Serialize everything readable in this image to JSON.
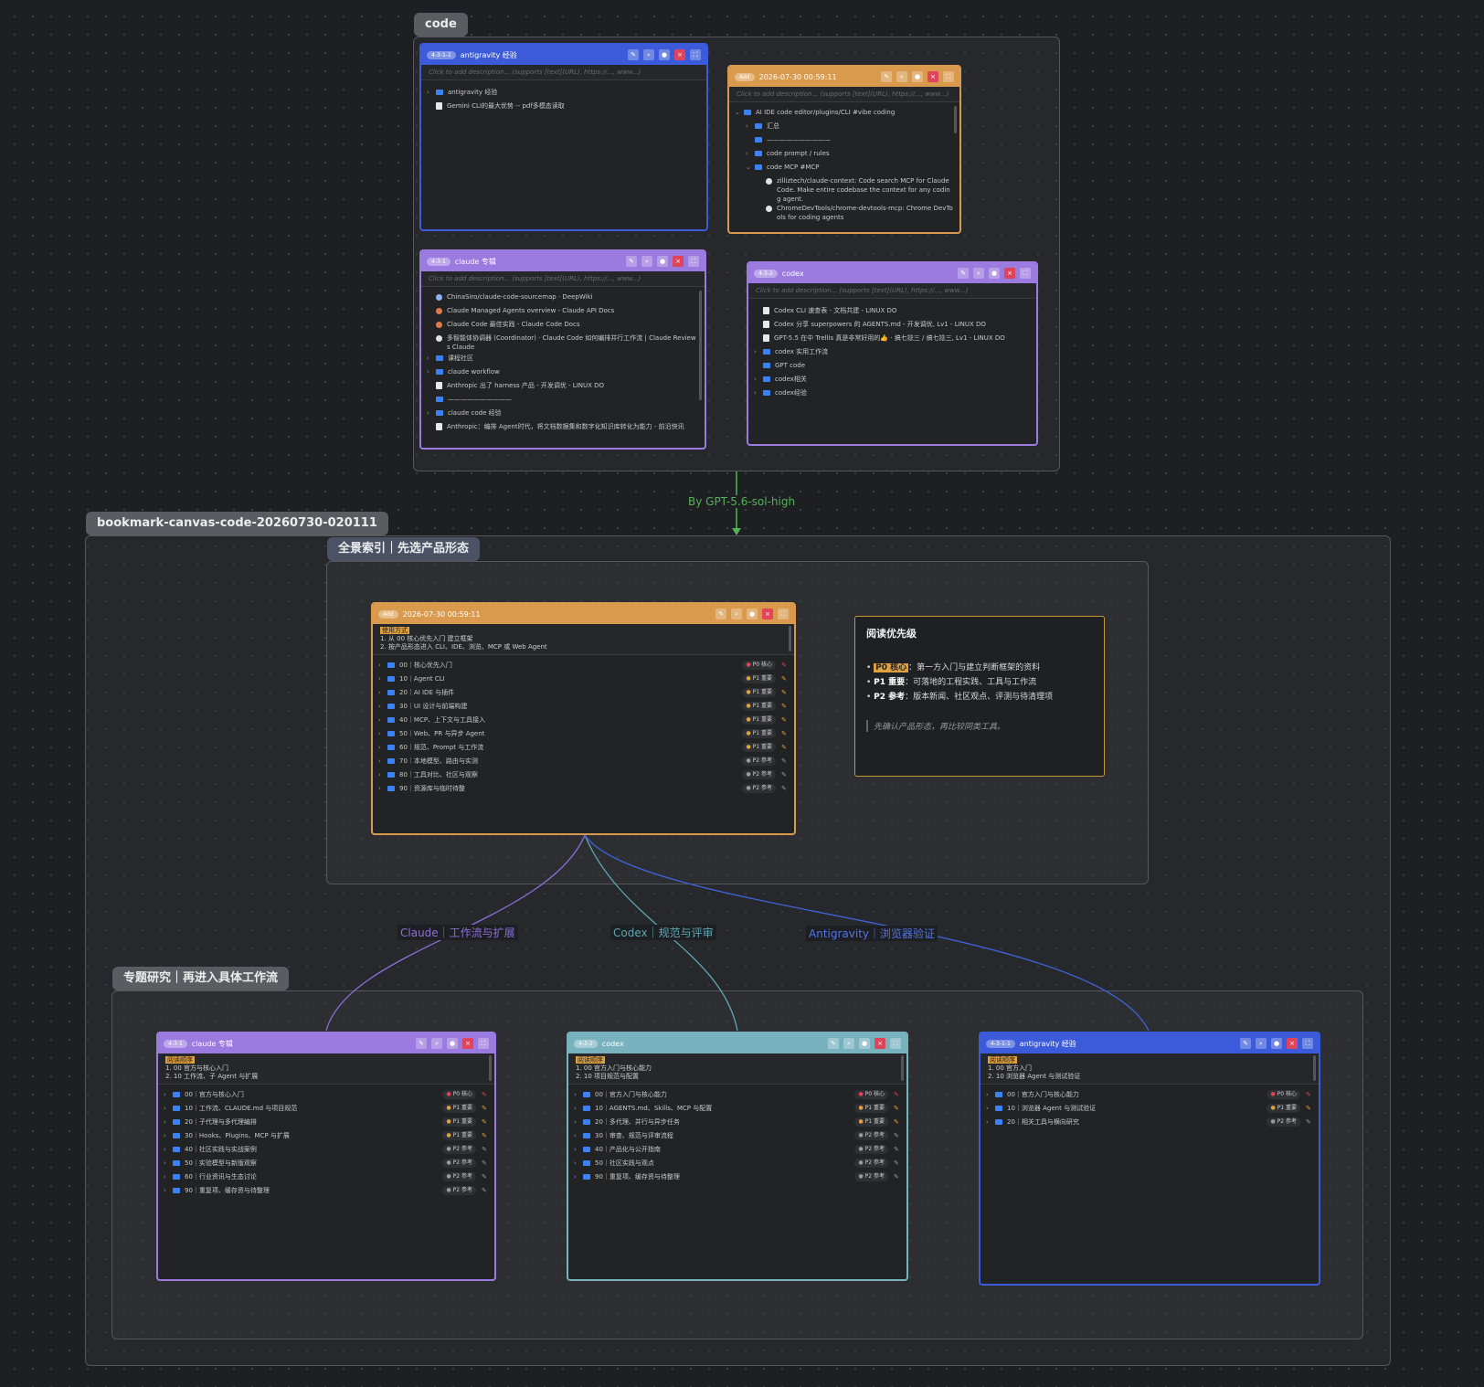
{
  "canvas": {
    "groups": {
      "code": "code",
      "bookmark_canvas": "bookmark-canvas-code-20260730-020111",
      "overview": "全景索引｜先选产品形态",
      "topic": "专题研究｜再进入具体工作流"
    },
    "edges": {
      "gpt": "By GPT-5.6-sol-high",
      "claude": "Claude｜工作流与扩展",
      "codex": "Codex｜规范与评审",
      "antigravity": "Antigravity｜浏览器验证"
    },
    "colors": {
      "blue_header": "#3b5bdb",
      "orange_header": "#d99a4e",
      "purple_header": "#9b7be0",
      "teal_header": "#79b2bf",
      "edge_green": "#52b356",
      "edge_purple": "#8b6fd8",
      "edge_teal": "#5fa6b4",
      "edge_blue": "#3e63d8"
    }
  },
  "nodes": {
    "antigravity_top": {
      "badge": "4-3-1-1",
      "title": "antigravity 经验",
      "desc": "Click to add description... (supports [text](URL), https://..., www...)",
      "rows": [
        {
          "label": "antigravity 经验"
        },
        {
          "label": "Gemini CLI的最大优势 -- pdf多模态读取"
        }
      ]
    },
    "orange_top": {
      "badge": "Add",
      "title": "2026-07-30 00:59:11",
      "desc": "Click to add description... (supports [text](URL), https://..., www...)",
      "rows": [
        {
          "label": "AI IDE code editor/plugins/CLI #vibe coding"
        },
        {
          "label": "汇总"
        },
        {
          "label": "——————————"
        },
        {
          "label": "code prompt / rules"
        },
        {
          "label": "code MCP #MCP"
        },
        {
          "label": "zilliztech/claude-context: Code search MCP for Claude Code. Make entire codebase the context for any coding agent."
        },
        {
          "label": "ChromeDevTools/chrome-devtools-mcp: Chrome DevTools for coding agents"
        }
      ]
    },
    "claude_top": {
      "badge": "4-3-1",
      "title": "claude 专辑",
      "desc": "Click to add description... (supports [text](URL), https://..., www...)",
      "rows": [
        {
          "label": "ChinaSiro/claude-code-sourcemap · DeepWiki"
        },
        {
          "label": "Claude Managed Agents overview - Claude API Docs"
        },
        {
          "label": "Claude Code 最佳实践 - Claude Code Docs"
        },
        {
          "label": "多智能体协调器 (Coordinator) · Claude Code 如何编排并行工作流 | Claude Reviews Claude"
        },
        {
          "label": "课程社区"
        },
        {
          "label": "claude workflow"
        },
        {
          "label": "Anthropic 出了 harness 产品 - 开发调优 - LINUX DO"
        },
        {
          "label": "——————————"
        },
        {
          "label": "claude code 经验"
        },
        {
          "label": "Anthropic：编排 Agent时代，将文档数据集和数字化知识库转化为能力 - 前沿快讯"
        }
      ]
    },
    "codex_top": {
      "badge": "4-3-2",
      "title": "codex",
      "desc": "Click to add description... (supports [text](URL), https://..., www...)",
      "rows": [
        {
          "label": "Codex CLI 速查表 - 文档共建 - LINUX DO"
        },
        {
          "label": "Codex 分享 superpowers 的 AGENTS.md - 开发调优, Lv1 - LINUX DO"
        },
        {
          "label": "GPT-5.5 在中 Trellis 真是非常好用的👍 · 搞七捻三 / 搞七捻三, Lv1 - LINUX DO"
        },
        {
          "label": "codex 实用工作流"
        },
        {
          "label": "GPT code"
        },
        {
          "label": "codex相关"
        },
        {
          "label": "codex经验"
        }
      ]
    },
    "overview_orange": {
      "badge": "Add",
      "title": "2026-07-30 00:59:11",
      "note_tag": "使用方式",
      "note_lines": [
        "1. 从 00 核心优先入门 建立框架",
        "2. 按产品形态进入 CLI、IDE、浏览、MCP 或 Web Agent"
      ],
      "rows": [
        {
          "label": "00｜核心优先入门",
          "tag": "P0 核心"
        },
        {
          "label": "10｜Agent CLI",
          "tag": "P1 重要"
        },
        {
          "label": "20｜AI IDE 与插件",
          "tag": "P1 重要"
        },
        {
          "label": "30｜UI 设计与前端构建",
          "tag": "P1 重要"
        },
        {
          "label": "40｜MCP、上下文与工具接入",
          "tag": "P1 重要"
        },
        {
          "label": "50｜Web、PR 与异步 Agent",
          "tag": "P1 重要"
        },
        {
          "label": "60｜规范、Prompt 与工作流",
          "tag": "P1 重要"
        },
        {
          "label": "70｜本地模型、路由与实测",
          "tag": "P2 参考"
        },
        {
          "label": "80｜工具对比、社区与观察",
          "tag": "P2 参考"
        },
        {
          "label": "90｜资源库与临时待整",
          "tag": "P2 参考"
        }
      ]
    },
    "claude_bottom": {
      "badge": "4-3-1",
      "title": "claude 专辑",
      "note_tag": "阅读顺序",
      "note_lines": [
        "1. 00 官方与核心入门",
        "2. 10 工作流、子 Agent 与扩展"
      ],
      "rows": [
        {
          "label": "00｜官方与核心入门",
          "tag": "P0 核心"
        },
        {
          "label": "10｜工作流、CLAUDE.md 与项目规范",
          "tag": "P1 重要"
        },
        {
          "label": "20｜子代理与多代理编排",
          "tag": "P1 重要"
        },
        {
          "label": "30｜Hooks、Plugins、MCP 与扩展",
          "tag": "P1 重要"
        },
        {
          "label": "40｜社区实践与实战案例",
          "tag": "P2 参考"
        },
        {
          "label": "50｜实验模型与新版观察",
          "tag": "P2 参考"
        },
        {
          "label": "60｜行业资讯与生态讨论",
          "tag": "P2 参考"
        },
        {
          "label": "90｜重复项、缓存资与待整理",
          "tag": "P2 参考"
        }
      ]
    },
    "codex_bottom": {
      "badge": "4-3-2",
      "title": "codex",
      "note_tag": "阅读顺序",
      "note_lines": [
        "1. 00 官方入门与核心能力",
        "2. 10 项目规范与配置"
      ],
      "rows": [
        {
          "label": "00｜官方入门与核心能力",
          "tag": "P0 核心"
        },
        {
          "label": "10｜AGENTS.md、Skills、MCP 与配置",
          "tag": "P1 重要"
        },
        {
          "label": "20｜多代理、并行与异步任务",
          "tag": "P1 重要"
        },
        {
          "label": "30｜审查、规范与评审流程",
          "tag": "P2 参考"
        },
        {
          "label": "40｜产品化与公开指南",
          "tag": "P2 参考"
        },
        {
          "label": "50｜社区实践与观点",
          "tag": "P2 参考"
        },
        {
          "label": "90｜重复项、缓存资与待整理",
          "tag": "P2 参考"
        }
      ]
    },
    "antigravity_bottom": {
      "badge": "4-3-1-1",
      "title": "antigravity 经验",
      "note_tag": "阅读顺序",
      "note_lines": [
        "1. 00 官方入门",
        "2. 10 浏览器 Agent 与测试验证"
      ],
      "rows": [
        {
          "label": "00｜官方入门与核心能力",
          "tag": "P0 核心"
        },
        {
          "label": "10｜浏览器 Agent 与测试验证",
          "tag": "P1 重要"
        },
        {
          "label": "20｜相关工具与横向研究",
          "tag": "P2 参考"
        }
      ]
    }
  },
  "reading_priority": {
    "title": "阅读优先级",
    "items": [
      {
        "key": "P0 核心",
        "text": "：第一方入门与建立判断框架的资料"
      },
      {
        "key": "P1 重要",
        "text": "：可落地的工程实践、工具与工作流"
      },
      {
        "key": "P2 参考",
        "text": "：版本新闻、社区观点、评测与待清理项"
      }
    ],
    "quote": "先确认产品形态，再比较同类工具。"
  }
}
